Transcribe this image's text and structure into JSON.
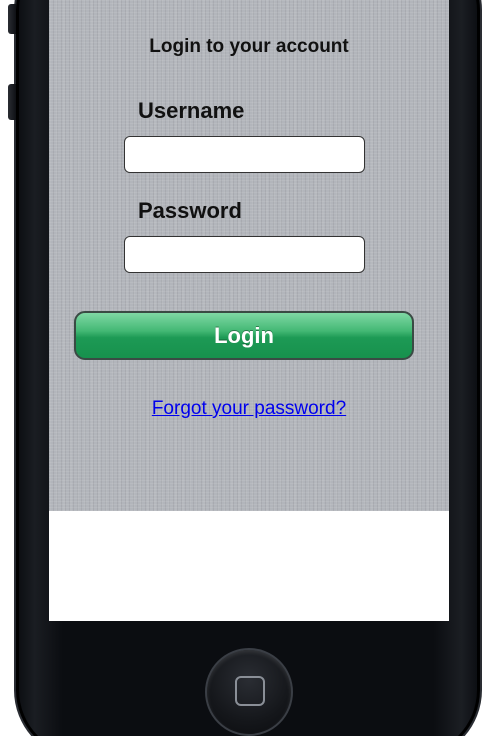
{
  "login": {
    "title": "Login to your account",
    "username_label": "Username",
    "username_value": "",
    "password_label": "Password",
    "password_value": "",
    "button_label": "Login",
    "forgot_link": "Forgot your password?"
  },
  "colors": {
    "button_green": "#1d9a55",
    "link_blue": "#0000ee",
    "background_linen": "#b2b5bb",
    "device_body": "#0b0d11"
  },
  "icons": {
    "home": "home-button-square-icon"
  }
}
